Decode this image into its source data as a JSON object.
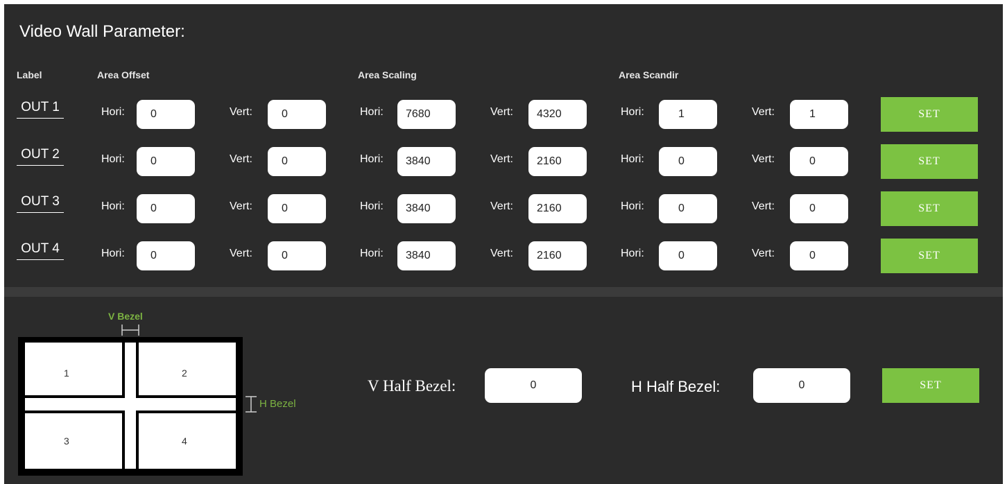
{
  "title": "Video Wall Parameter:",
  "headers": {
    "label": "Label",
    "offset": "Area Offset",
    "scaling": "Area Scaling",
    "scandir": "Area Scandir"
  },
  "field_labels": {
    "hori": "Hori:",
    "vert": "Vert:"
  },
  "rows": [
    {
      "label": "OUT 1",
      "offset_h": "0",
      "offset_v": "0",
      "scale_h": "7680",
      "scale_v": "4320",
      "scan_h": "1",
      "scan_v": "1",
      "button": "SET"
    },
    {
      "label": "OUT 2",
      "offset_h": "0",
      "offset_v": "0",
      "scale_h": "3840",
      "scale_v": "2160",
      "scan_h": "0",
      "scan_v": "0",
      "button": "SET"
    },
    {
      "label": "OUT 3",
      "offset_h": "0",
      "offset_v": "0",
      "scale_h": "3840",
      "scale_v": "2160",
      "scan_h": "0",
      "scan_v": "0",
      "button": "SET"
    },
    {
      "label": "OUT 4",
      "offset_h": "0",
      "offset_v": "0",
      "scale_h": "3840",
      "scale_v": "2160",
      "scan_h": "0",
      "scan_v": "0",
      "button": "SET"
    }
  ],
  "diagram": {
    "v_bezel": "V Bezel",
    "h_bezel": "H Bezel",
    "cells": [
      "1",
      "2",
      "3",
      "4"
    ]
  },
  "bezel": {
    "v_label": "V Half Bezel:",
    "v_value": "0",
    "h_label": "H Half Bezel:",
    "h_value": "0",
    "button": "SET"
  },
  "colors": {
    "background": "#2b2b2b",
    "accent": "#7cc242",
    "bezel_label": "#7cb342"
  }
}
